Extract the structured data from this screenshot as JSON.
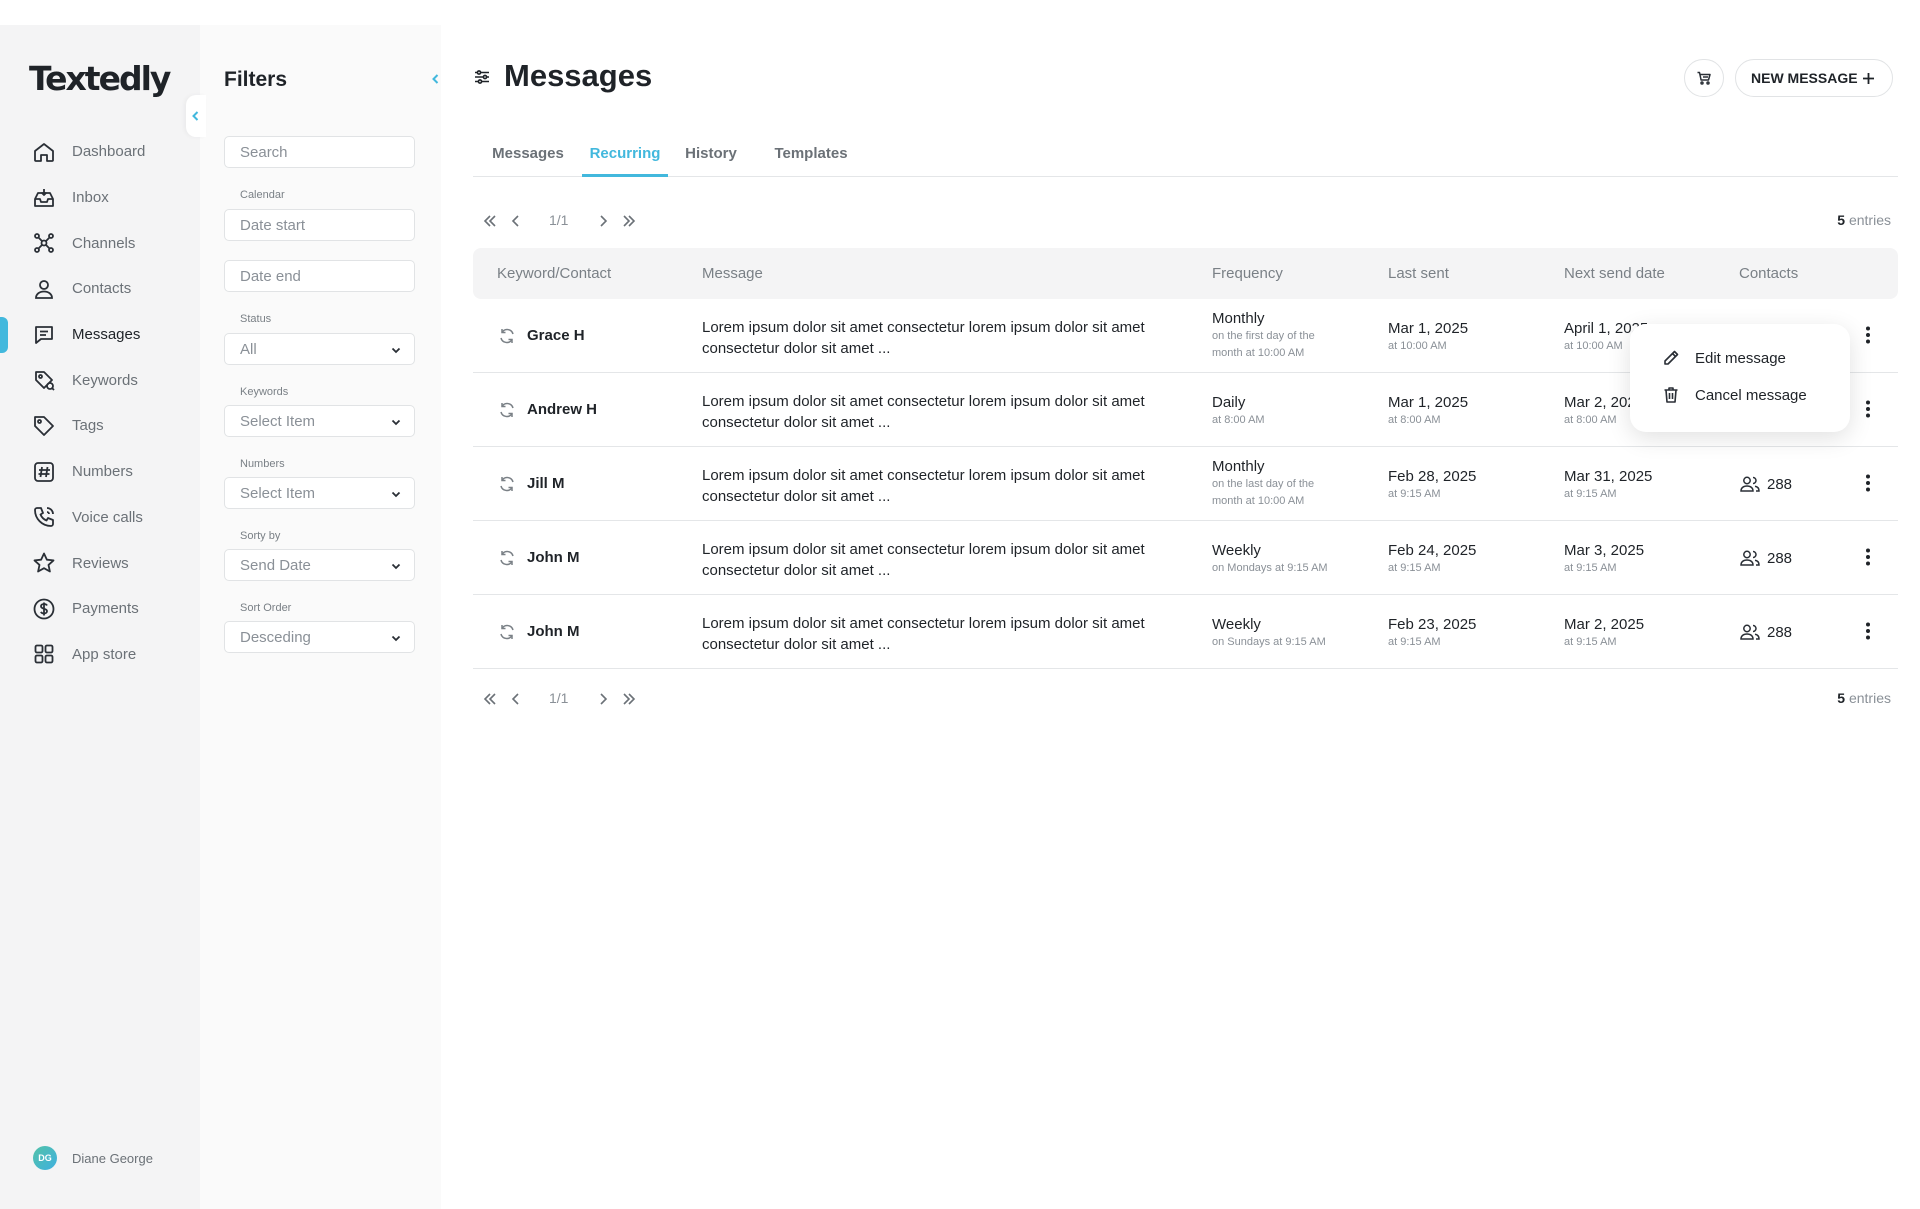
{
  "app": {
    "logo": "Textedly"
  },
  "nav": {
    "items": [
      {
        "label": "Dashboard",
        "icon": "home-icon"
      },
      {
        "label": "Inbox",
        "icon": "inbox-icon"
      },
      {
        "label": "Channels",
        "icon": "channels-icon"
      },
      {
        "label": "Contacts",
        "icon": "user-icon"
      },
      {
        "label": "Messages",
        "icon": "message-icon",
        "active": true
      },
      {
        "label": "Keywords",
        "icon": "keyword-tag-icon"
      },
      {
        "label": "Tags",
        "icon": "tag-icon"
      },
      {
        "label": "Numbers",
        "icon": "hash-icon"
      },
      {
        "label": "Voice calls",
        "icon": "phone-icon"
      },
      {
        "label": "Reviews",
        "icon": "star-icon"
      },
      {
        "label": "Payments",
        "icon": "dollar-icon"
      },
      {
        "label": "App store",
        "icon": "grid-icon"
      }
    ],
    "user": {
      "initials": "DG",
      "name": "Diane George"
    }
  },
  "filters": {
    "title": "Filters",
    "search_placeholder": "Search",
    "calendar_label": "Calendar",
    "date_start_placeholder": "Date start",
    "date_end_placeholder": "Date end",
    "status_label": "Status",
    "status_value": "All",
    "keywords_label": "Keywords",
    "keywords_value": "Select Item",
    "numbers_label": "Numbers",
    "numbers_value": "Select Item",
    "sort_by_label": "Sorty by",
    "sort_by_value": "Send Date",
    "sort_order_label": "Sort Order",
    "sort_order_value": "Desceding"
  },
  "header": {
    "title": "Messages",
    "new_message_label": "NEW MESSAGE"
  },
  "tabs": [
    {
      "label": "Messages"
    },
    {
      "label": "Recurring",
      "active": true
    },
    {
      "label": "History"
    },
    {
      "label": "Templates"
    }
  ],
  "pagination": {
    "page": "1/1",
    "entries_count": "5",
    "entries_label": "entries"
  },
  "table": {
    "columns": [
      "Keyword/Contact",
      "Message",
      "Frequency",
      "Last sent",
      "Next send date",
      "Contacts"
    ],
    "rows": [
      {
        "contact": "Grace H",
        "message": "Lorem ipsum dolor sit amet consectetur lorem ipsum dolor sit amet consectetur dolor sit amet ...",
        "frequency": "Monthly",
        "frequency_detail": "on the first day of the month at 10:00 AM",
        "last_sent": "Mar 1, 2025",
        "last_sent_time": "at 10:00 AM",
        "next_send": "April 1, 2025",
        "next_send_time": "at 10:00 AM",
        "contacts": ""
      },
      {
        "contact": "Andrew H",
        "message": "Lorem ipsum dolor sit amet consectetur lorem ipsum dolor sit amet consectetur dolor sit amet ...",
        "frequency": "Daily",
        "frequency_detail": "at 8:00 AM",
        "last_sent": "Mar 1, 2025",
        "last_sent_time": "at 8:00 AM",
        "next_send": "Mar 2, 2025",
        "next_send_time": "at 8:00 AM",
        "contacts": ""
      },
      {
        "contact": "Jill M",
        "message": "Lorem ipsum dolor sit amet consectetur lorem ipsum dolor sit amet consectetur dolor sit amet ...",
        "frequency": "Monthly",
        "frequency_detail": "on the last day of the month at 10:00 AM",
        "last_sent": "Feb 28, 2025",
        "last_sent_time": "at 9:15 AM",
        "next_send": "Mar 31, 2025",
        "next_send_time": "at 9:15 AM",
        "contacts": "288"
      },
      {
        "contact": "John M",
        "message": "Lorem ipsum dolor sit amet consectetur lorem ipsum dolor sit amet consectetur dolor sit amet ...",
        "frequency": "Weekly",
        "frequency_detail": "on Mondays at 9:15 AM",
        "last_sent": "Feb 24, 2025",
        "last_sent_time": "at 9:15 AM",
        "next_send": "Mar 3, 2025",
        "next_send_time": "at 9:15 AM",
        "contacts": "288"
      },
      {
        "contact": "John M",
        "message": "Lorem ipsum dolor sit amet consectetur lorem ipsum dolor sit amet consectetur dolor sit amet ...",
        "frequency": "Weekly",
        "frequency_detail": "on Sundays at 9:15 AM",
        "last_sent": "Feb 23, 2025",
        "last_sent_time": "at 9:15 AM",
        "next_send": "Mar 2, 2025",
        "next_send_time": "at 9:15 AM",
        "contacts": "288"
      }
    ]
  },
  "row_menu": {
    "edit_label": "Edit message",
    "cancel_label": "Cancel message"
  },
  "colors": {
    "accent": "#42b8dd",
    "text": "#1f2328",
    "muted": "#7a8086",
    "sidebar_bg": "#f4f4f5"
  }
}
